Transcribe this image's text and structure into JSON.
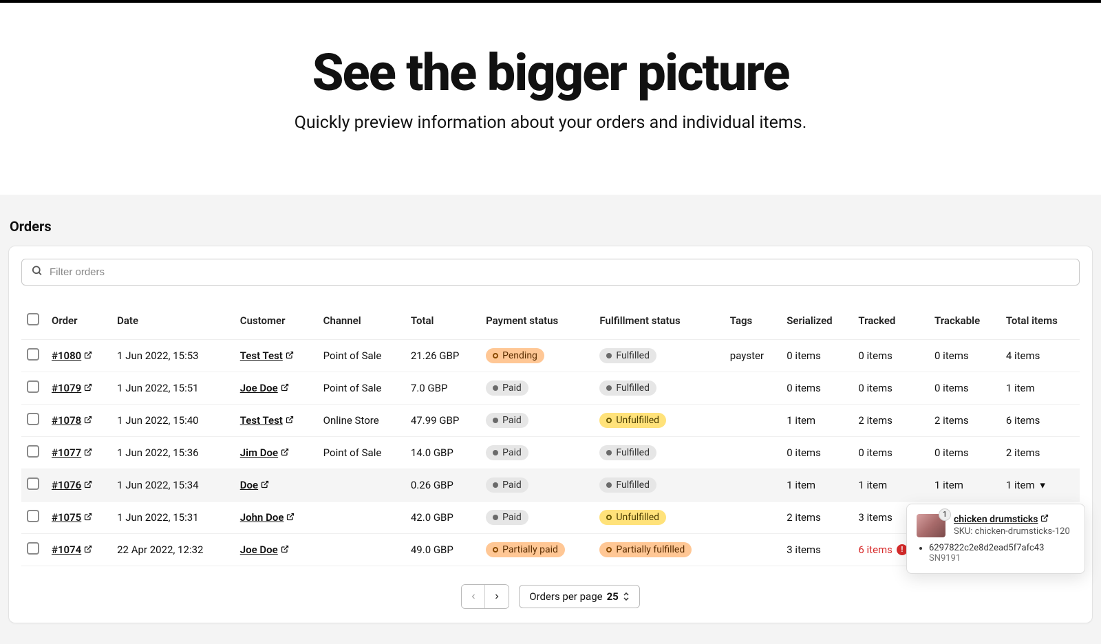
{
  "hero": {
    "title": "See the bigger picture",
    "subtitle": "Quickly preview information about your orders and individual items."
  },
  "section": {
    "title": "Orders"
  },
  "search": {
    "placeholder": "Filter orders"
  },
  "columns": {
    "order": "Order",
    "date": "Date",
    "customer": "Customer",
    "channel": "Channel",
    "total": "Total",
    "payment": "Payment status",
    "fulfillment": "Fulfillment status",
    "tags": "Tags",
    "serialized": "Serialized",
    "tracked": "Tracked",
    "trackable": "Trackable",
    "totalitems": "Total items"
  },
  "rows": [
    {
      "id": "#1080",
      "date": "1 Jun 2022, 15:53",
      "customer": "Test Test",
      "channel": "Point of Sale",
      "total": "21.26 GBP",
      "payment": {
        "label": "Pending",
        "cls": "orange"
      },
      "fulfillment": {
        "label": "Fulfilled",
        "cls": "grey"
      },
      "tags": "payster",
      "serialized": "0 items",
      "tracked": "0 items",
      "trackable": "0 items",
      "totalitems": "4 items"
    },
    {
      "id": "#1079",
      "date": "1 Jun 2022, 15:51",
      "customer": "Joe Doe",
      "channel": "Point of Sale",
      "total": "7.0 GBP",
      "payment": {
        "label": "Paid",
        "cls": "grey"
      },
      "fulfillment": {
        "label": "Fulfilled",
        "cls": "grey"
      },
      "tags": "",
      "serialized": "0 items",
      "tracked": "0 items",
      "trackable": "0 items",
      "totalitems": "1 item"
    },
    {
      "id": "#1078",
      "date": "1 Jun 2022, 15:40",
      "customer": "Test Test",
      "channel": "Online Store",
      "total": "47.99 GBP",
      "payment": {
        "label": "Paid",
        "cls": "grey"
      },
      "fulfillment": {
        "label": "Unfulfilled",
        "cls": "yellow"
      },
      "tags": "",
      "serialized": "1 item",
      "tracked": "2 items",
      "trackable": "2 items",
      "totalitems": "6 items"
    },
    {
      "id": "#1077",
      "date": "1 Jun 2022, 15:36",
      "customer": "Jim Doe",
      "channel": "Point of Sale",
      "total": "14.0 GBP",
      "payment": {
        "label": "Paid",
        "cls": "grey"
      },
      "fulfillment": {
        "label": "Fulfilled",
        "cls": "grey"
      },
      "tags": "",
      "serialized": "0 items",
      "tracked": "0 items",
      "trackable": "0 items",
      "totalitems": "2 items"
    },
    {
      "id": "#1076",
      "date": "1 Jun 2022, 15:34",
      "customer": "Doe",
      "channel": "",
      "total": "0.26 GBP",
      "payment": {
        "label": "Paid",
        "cls": "grey"
      },
      "fulfillment": {
        "label": "Fulfilled",
        "cls": "grey"
      },
      "tags": "",
      "serialized": "1 item",
      "tracked": "1 item",
      "trackable": "1 item",
      "totalitems": "1 item",
      "highlight": true,
      "caret": true
    },
    {
      "id": "#1075",
      "date": "1 Jun 2022, 15:31",
      "customer": "John Doe",
      "channel": "",
      "total": "42.0 GBP",
      "payment": {
        "label": "Paid",
        "cls": "grey"
      },
      "fulfillment": {
        "label": "Unfulfilled",
        "cls": "yellow"
      },
      "tags": "",
      "serialized": "2 items",
      "tracked": "3 items",
      "trackable": "",
      "totalitems": ""
    },
    {
      "id": "#1074",
      "date": "22 Apr 2022, 12:32",
      "customer": "Joe Doe",
      "channel": "",
      "total": "49.0 GBP",
      "payment": {
        "label": "Partially paid",
        "cls": "orange"
      },
      "fulfillment": {
        "label": "Partially fulfilled",
        "cls": "orange"
      },
      "tags": "",
      "serialized": "3 items",
      "tracked": "6 items",
      "tracked_alert": true,
      "trackable": "",
      "totalitems": ""
    }
  ],
  "pagination": {
    "perpage_label": "Orders per page",
    "perpage_value": "25"
  },
  "popover": {
    "count": "1",
    "title": "chicken drumsticks",
    "sku_label": "SKU: chicken-drumsticks-120",
    "hash": "6297822c2e8d2ead5f7afc43",
    "serial": "SN9191"
  }
}
